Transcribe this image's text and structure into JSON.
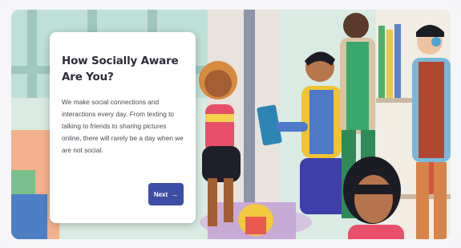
{
  "card": {
    "title": "How Socially Aware Are You?",
    "body": "We make social connections and interactions every day. From texting to talking to friends to sharing pictures online, there will rarely be a day when we are not social.",
    "next_label": "Next",
    "next_icon": "arrow-right-icon",
    "next_glyph": "→"
  },
  "colors": {
    "button": "#3c4ea6",
    "card_background": "#ffffff",
    "title_text": "#2c2c3a"
  }
}
